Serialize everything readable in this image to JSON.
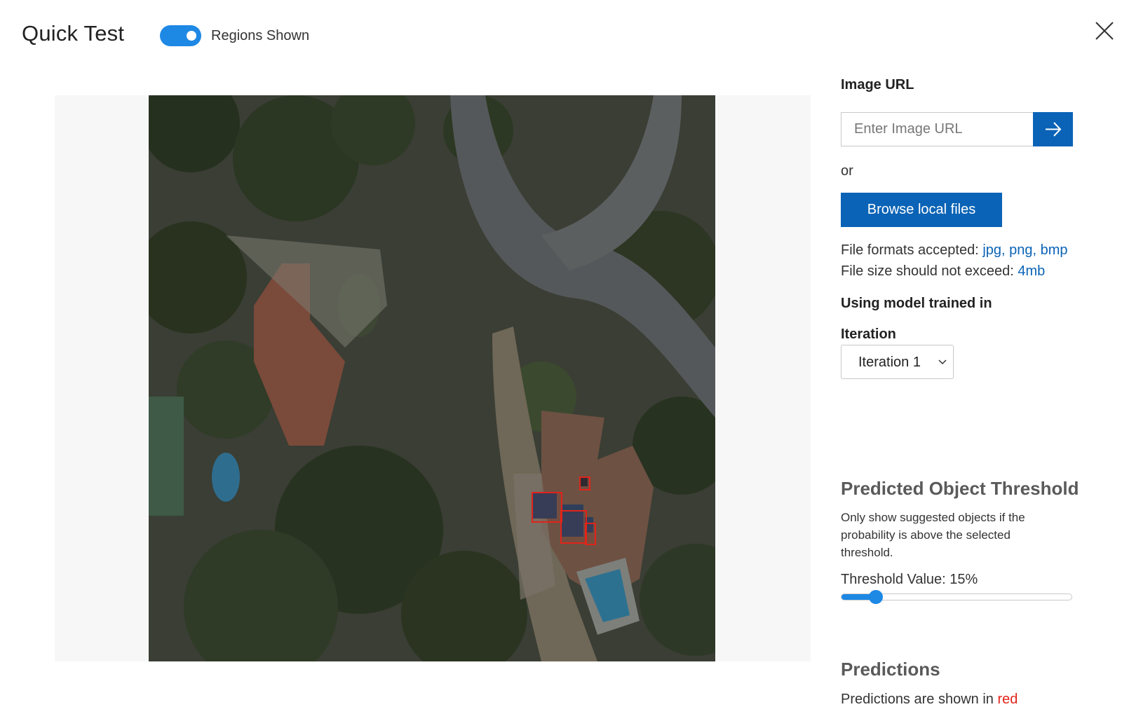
{
  "header": {
    "title": "Quick Test",
    "toggle_label": "Regions Shown",
    "toggle_on": true,
    "close_icon": "close-icon"
  },
  "image": {
    "icon": "aerial-photo",
    "detected_region_count": 4
  },
  "side": {
    "image_url_label": "Image URL",
    "url_placeholder": "Enter Image URL",
    "url_value": "",
    "go_icon": "arrow-right-icon",
    "or_text": "or",
    "browse_label": "Browse local files",
    "formats_prefix": "File formats accepted: ",
    "formats_value": "jpg, png, bmp",
    "size_prefix": "File size should not exceed: ",
    "size_value": "4mb",
    "model_label": "Using model trained in",
    "iteration_label": "Iteration",
    "iteration_value": "Iteration 1",
    "threshold_title": "Predicted Object Threshold",
    "threshold_desc": "Only show suggested objects if the probability is above the selected threshold.",
    "threshold_label": "Threshold Value: 15%",
    "threshold_percent": 15,
    "predictions_title": "Predictions",
    "predictions_prefix": "Predictions are shown in ",
    "predictions_color_word": "red"
  },
  "colors": {
    "accent": "#1e88e5",
    "button": "#0a63b6",
    "prediction": "#e2231a"
  }
}
